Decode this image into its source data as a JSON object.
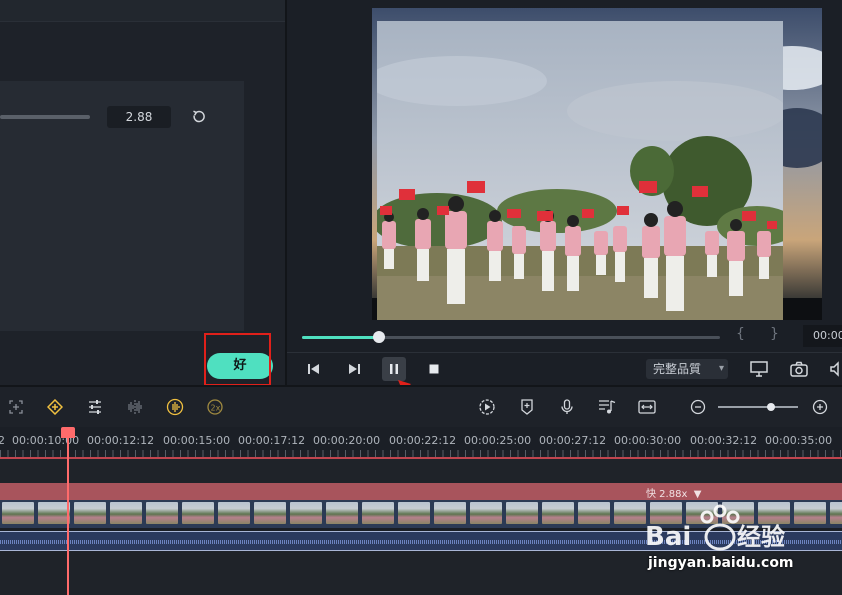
{
  "properties": {
    "speed_value": "2.88",
    "ok_label": "好"
  },
  "preview": {
    "current_time": "00:00",
    "in_mark": "{",
    "out_mark": "}",
    "progress": 0.18,
    "quality": "完整品質"
  },
  "timeline": {
    "ruler": [
      "00:00:10:00",
      "00:00:12:12",
      "00:00:15:00",
      "00:00:17:12",
      "00:00:20:00",
      "00:00:22:12",
      "00:00:25:00",
      "00:00:27:12",
      "00:00:30:00",
      "00:00:32:12",
      "00:00:35:00"
    ],
    "ruler_prefix": "2",
    "speed_tag": "快 2.88x",
    "zoom_level": 0.66
  },
  "watermark": {
    "brand": "Baidu经验",
    "url": "jingyan.baidu.com"
  },
  "colors": {
    "accent": "#4fe0c0",
    "annotation": "#e0201a",
    "playhead": "#ff6b6b",
    "speed_bar": "#a8545c"
  }
}
